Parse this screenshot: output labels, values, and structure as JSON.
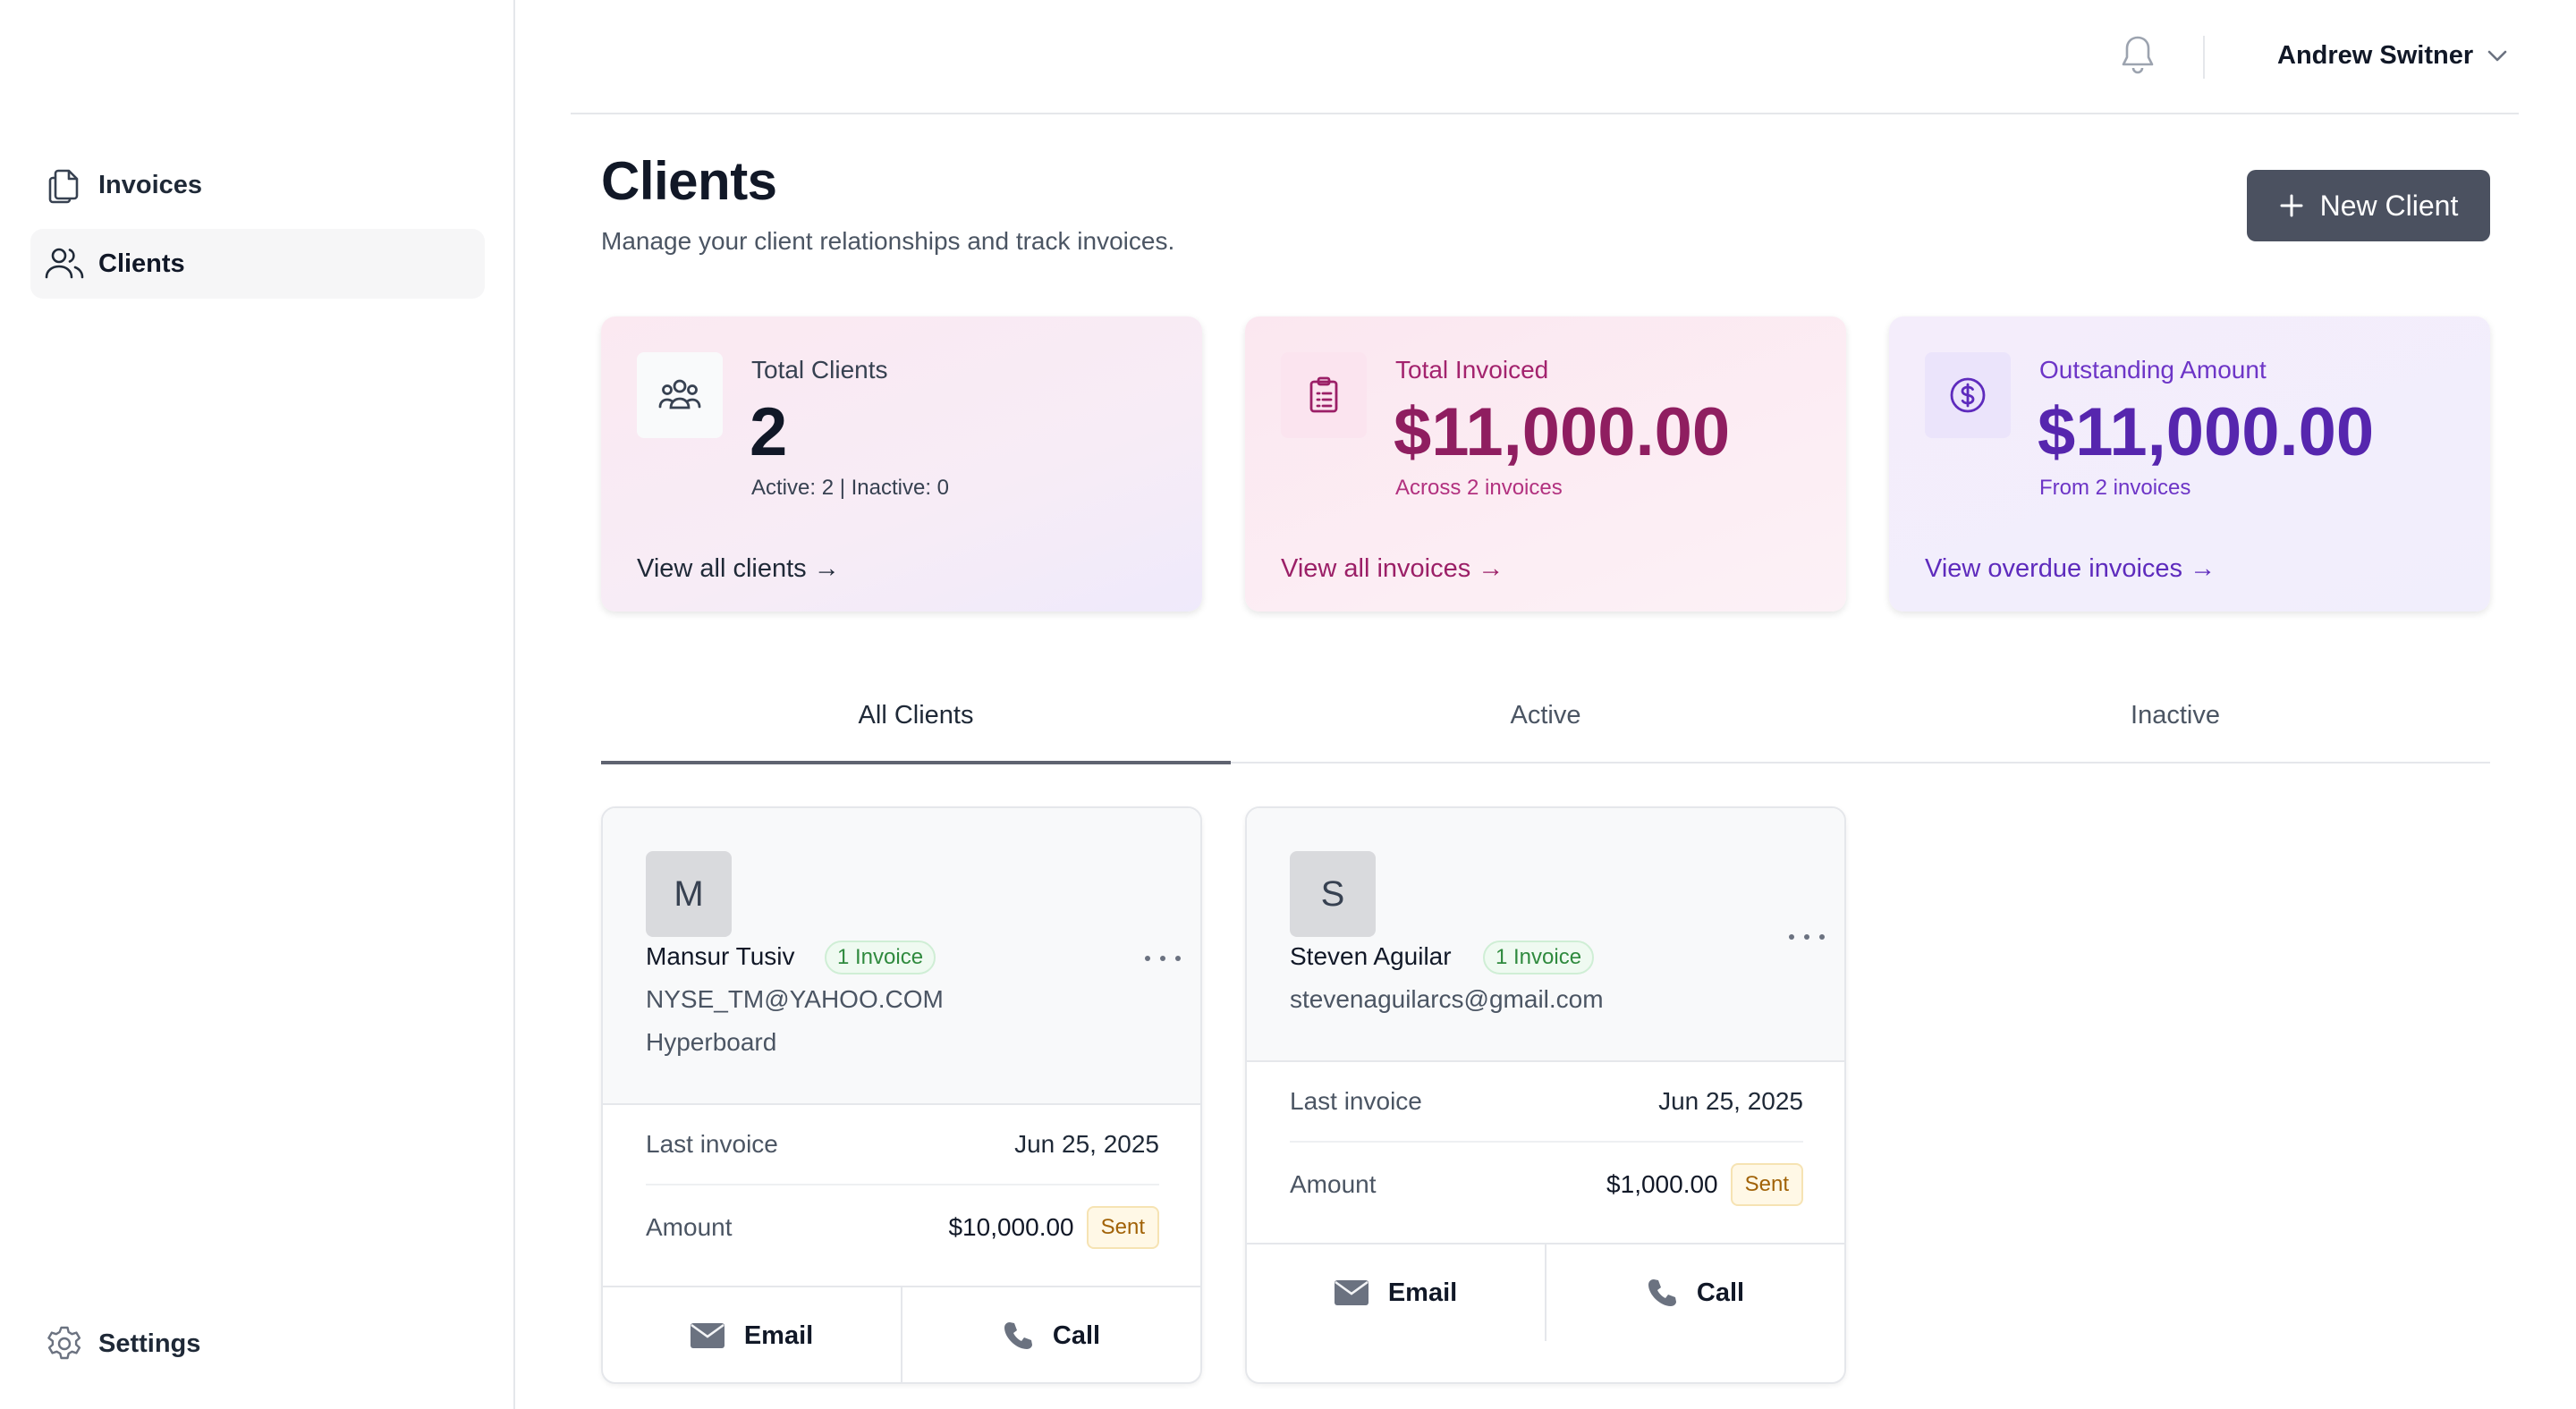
{
  "sidebar": {
    "items": [
      {
        "label": "Invoices",
        "icon": "documents-icon"
      },
      {
        "label": "Clients",
        "icon": "users-icon",
        "active": true
      }
    ],
    "settings_label": "Settings"
  },
  "topbar": {
    "user_name": "Andrew Switner"
  },
  "header": {
    "title": "Clients",
    "subtitle": "Manage your client relationships and track invoices.",
    "new_client_label": "New Client"
  },
  "stats": [
    {
      "title": "Total Clients",
      "value": "2",
      "sub": "Active: 2 | Inactive: 0",
      "link": "View all clients →"
    },
    {
      "title": "Total Invoiced",
      "value": "$11,000.00",
      "sub": "Across 2 invoices",
      "link": "View all invoices →"
    },
    {
      "title": "Outstanding Amount",
      "value": "$11,000.00",
      "sub": "From 2 invoices",
      "link": "View overdue invoices →"
    }
  ],
  "tabs": [
    {
      "label": "All Clients",
      "active": true
    },
    {
      "label": "Active"
    },
    {
      "label": "Inactive"
    }
  ],
  "clients": [
    {
      "initial": "M",
      "name": "Mansur Tusiv",
      "badge": "1 Invoice",
      "email": "NYSE_TM@YAHOO.COM",
      "company": "Hyperboard",
      "last_invoice_label": "Last invoice",
      "last_invoice": "Jun 25, 2025",
      "amount_label": "Amount",
      "amount": "$10,000.00",
      "status": "Sent",
      "email_action": "Email",
      "call_action": "Call"
    },
    {
      "initial": "S",
      "name": "Steven Aguilar",
      "badge": "1 Invoice",
      "email": "stevenaguilarcs@gmail.com",
      "last_invoice_label": "Last invoice",
      "last_invoice": "Jun 25, 2025",
      "amount_label": "Amount",
      "amount": "$1,000.00",
      "status": "Sent",
      "email_action": "Email",
      "call_action": "Call"
    }
  ],
  "colors": {
    "primary_button": "#4b5160",
    "invoiced_accent": "#8f1e60",
    "outstanding_accent": "#5626ae",
    "badge_green": "#2f8a3e",
    "status_sent": "#a16207"
  }
}
